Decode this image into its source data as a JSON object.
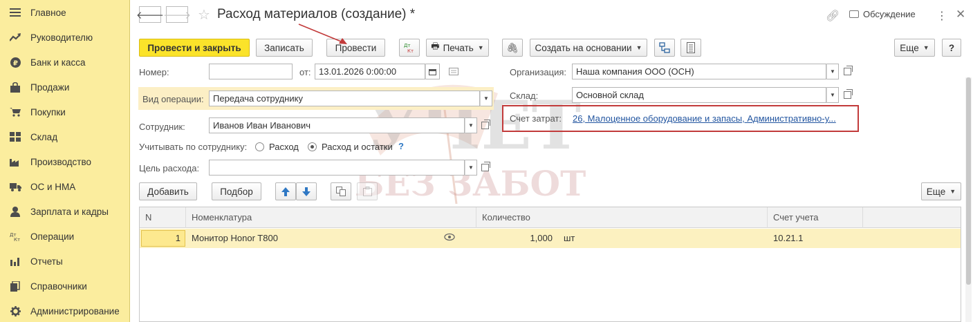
{
  "sidebar": {
    "items": [
      {
        "label": "Главное",
        "icon": "menu-icon"
      },
      {
        "label": "Руководителю",
        "icon": "trend-icon"
      },
      {
        "label": "Банк и касса",
        "icon": "ruble-icon"
      },
      {
        "label": "Продажи",
        "icon": "bag-icon"
      },
      {
        "label": "Покупки",
        "icon": "cart-icon"
      },
      {
        "label": "Склад",
        "icon": "warehouse-icon"
      },
      {
        "label": "Производство",
        "icon": "factory-icon"
      },
      {
        "label": "ОС и НМА",
        "icon": "truck-icon"
      },
      {
        "label": "Зарплата и кадры",
        "icon": "person-icon"
      },
      {
        "label": "Операции",
        "icon": "dt-kt-icon"
      },
      {
        "label": "Отчеты",
        "icon": "bar-chart-icon"
      },
      {
        "label": "Справочники",
        "icon": "books-icon"
      },
      {
        "label": "Администрирование",
        "icon": "gear-icon"
      }
    ]
  },
  "header": {
    "title": "Расход материалов (создание) *",
    "discussion_label": "Обсуждение"
  },
  "toolbar": {
    "post_close": "Провести и закрыть",
    "save": "Записать",
    "post": "Провести",
    "print": "Печать",
    "create_based": "Создать на основании",
    "more": "Еще",
    "help": "?"
  },
  "form": {
    "number_label": "Номер:",
    "number_value": "",
    "date_label": "от:",
    "date_value": "13.01.2026  0:00:00",
    "org_label": "Организация:",
    "org_value": "Наша компания ООО (ОСН)",
    "warehouse_label": "Склад:",
    "warehouse_value": "Основной склад",
    "optype_label": "Вид операции:",
    "optype_value": "Передача сотруднику",
    "cost_account_label": "Счет затрат:",
    "cost_account_value": "26, Малоценное оборудование и запасы, Административно-у...",
    "employee_label": "Сотрудник:",
    "employee_value": "Иванов Иван Иванович",
    "track_label": "Учитывать по сотруднику:",
    "track_opt1": "Расход",
    "track_opt2": "Расход и остатки",
    "track_help": "?",
    "purpose_label": "Цель расхода:",
    "purpose_value": ""
  },
  "table_toolbar": {
    "add": "Добавить",
    "pick": "Подбор",
    "more": "Еще"
  },
  "table": {
    "columns": [
      "N",
      "Номенклатура",
      "Количество",
      "Счет учета"
    ],
    "rows": [
      {
        "n": "1",
        "item": "Монитор Honor T800",
        "qty": "1,000",
        "unit": "шт",
        "account": "10.21.1"
      }
    ]
  },
  "watermark": {
    "line1": "УЧЕТ",
    "line2": "БЕЗ ЗАБОТ"
  },
  "colors": {
    "sidebar_bg": "#fbed9e",
    "primary_button": "#fbe32a",
    "highlight_box": "#c23a3a",
    "link": "#2255a0"
  }
}
